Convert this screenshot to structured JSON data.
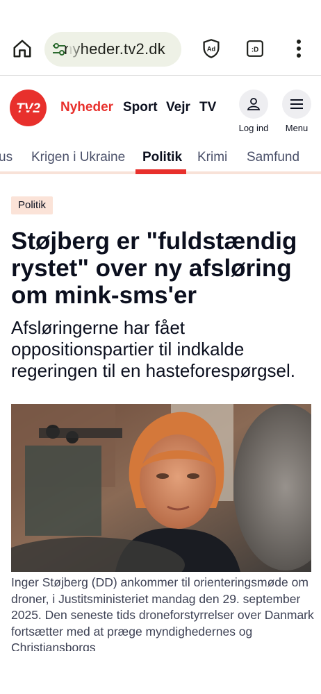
{
  "browser": {
    "url": "nyheder.tv2.dk",
    "icons": [
      "home-icon",
      "site-settings-icon",
      "adblock-icon",
      "tab-switcher-icon",
      "more-vert-icon"
    ]
  },
  "site": {
    "logo_text": "TV2",
    "brand_color": "#e8302c",
    "nav": {
      "news": "Nyheder",
      "sport": "Sport",
      "weather": "Vejr",
      "tv": "TV"
    },
    "login_label": "Log ind",
    "menu_label": "Menu"
  },
  "sections": {
    "items": [
      "us",
      "Krigen i Ukraine",
      "Politik",
      "Krimi",
      "Samfund"
    ],
    "active": "Politik"
  },
  "article": {
    "tag": "Politik",
    "headline": "Støjberg er \"fuldstændig rystet\" over ny afsløring om mink-sms'er",
    "subheadline": "Afsløringerne har fået oppositionspartier til indkalde regeringen til en hasteforespørgsel.",
    "caption": "Inger Støjberg (DD) ankommer til orienteringsmøde om droner, i Justitsministeriet mandag den 29. september 2025. Den seneste tids droneforstyrrelser over Danmark fortsætter med at præge myndighedernes og Christiansborgs"
  }
}
